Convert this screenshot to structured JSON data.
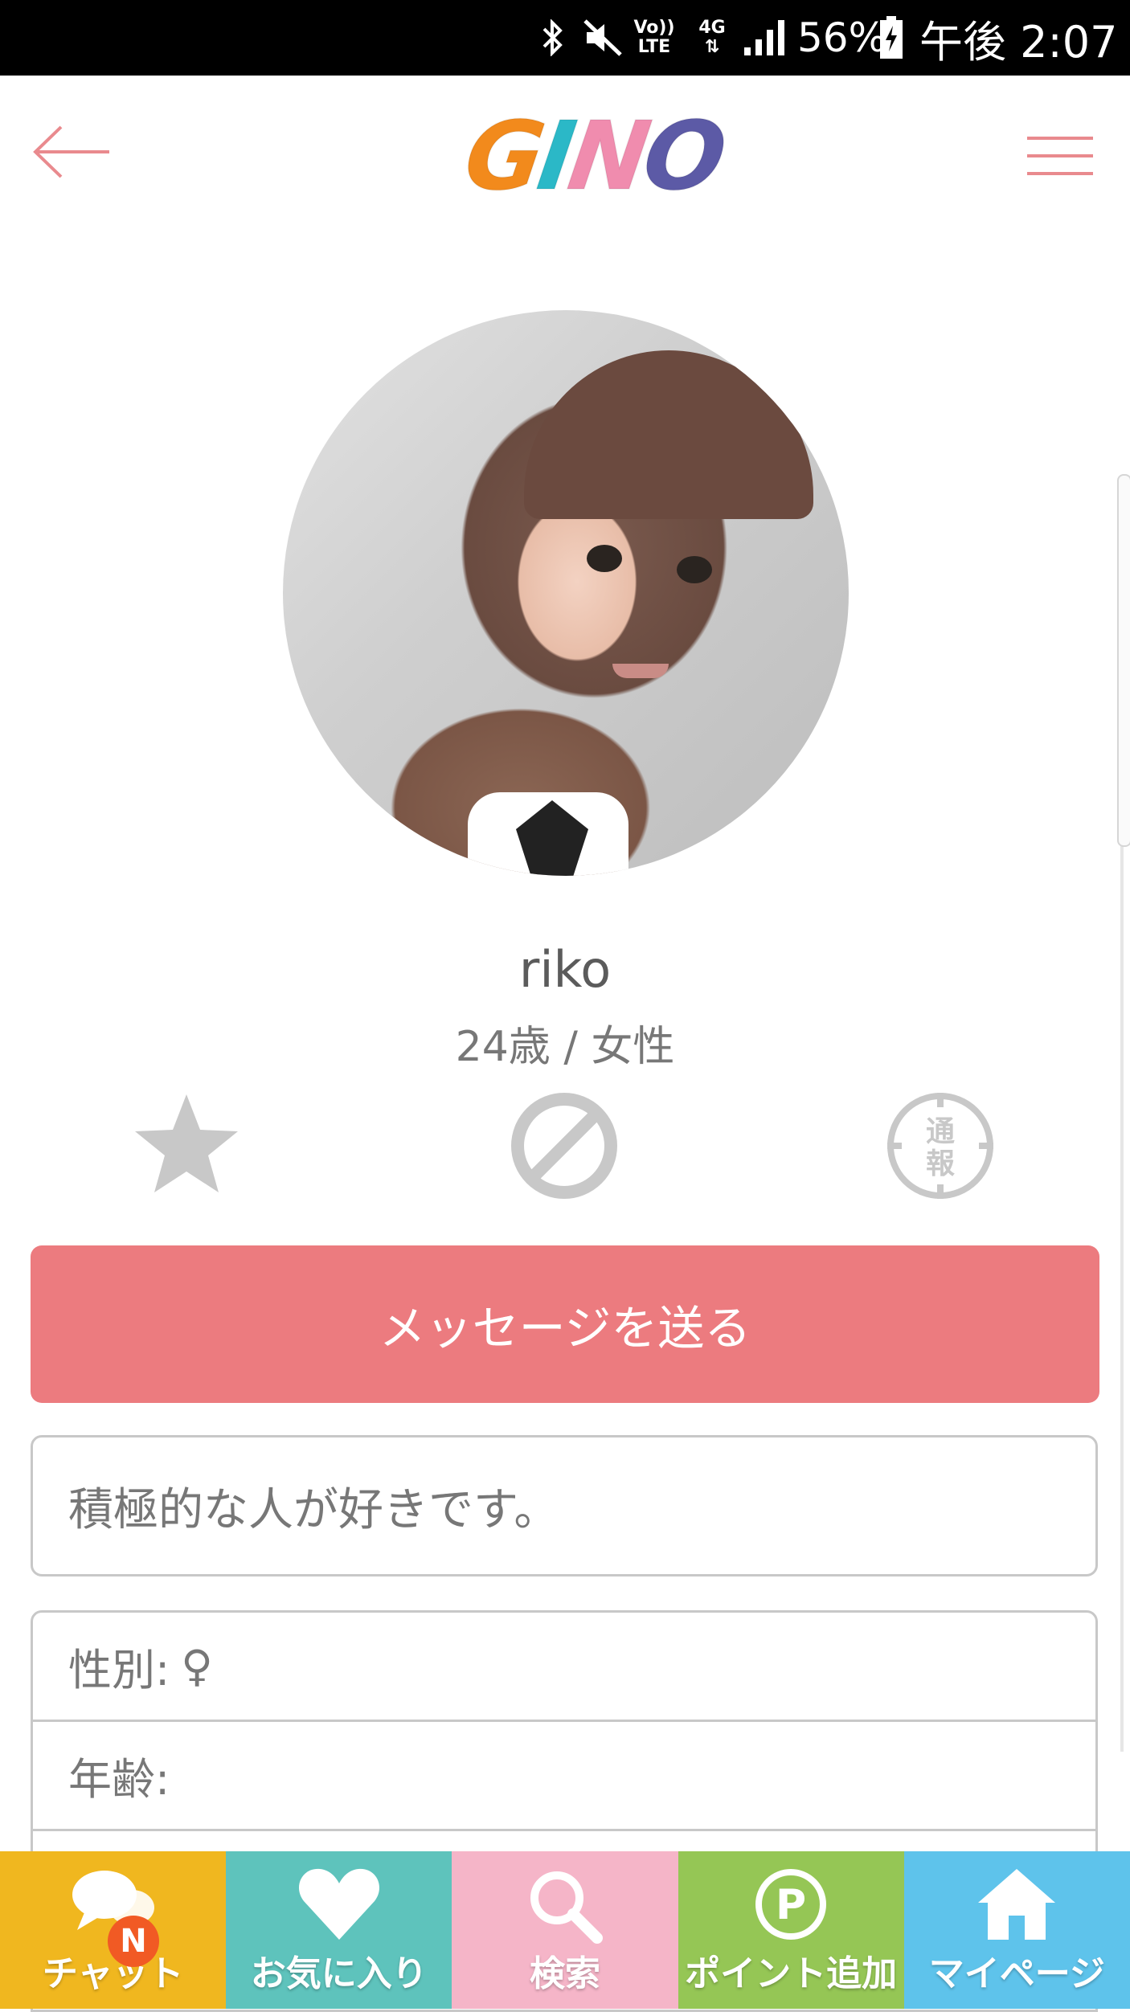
{
  "status_bar": {
    "bluetooth_icon": "bluetooth-icon",
    "volte_top": "Vo))",
    "volte_bottom": "LTE",
    "network_type": "4G",
    "battery_percent": "56%",
    "time": "午後 2:07"
  },
  "header": {
    "logo_letters": [
      "G",
      "I",
      "N",
      "O"
    ],
    "logo_colors": [
      "#f28a1c",
      "#2bb8c7",
      "#f08cae",
      "#5c5aa6"
    ],
    "back_icon": "arrow-left-icon",
    "menu_icon": "hamburger-menu-icon"
  },
  "profile": {
    "username": "riko",
    "age_gender": "24歳 / 女性",
    "actions": {
      "favorite_icon": "star-icon",
      "block_icon": "block-icon",
      "report_icon": "report-icon",
      "report_char1": "通",
      "report_char2": "報"
    },
    "send_message_label": "メッセージを送る",
    "bio": "積極的な人が好きです。",
    "info": [
      {
        "label": "性別:",
        "value": "♀"
      },
      {
        "label": "年齢:",
        "value": ""
      }
    ]
  },
  "bottom_nav": [
    {
      "label": "チャット",
      "color": "#f0b71f",
      "icon": "chat-bubble-icon",
      "badge": "N"
    },
    {
      "label": "お気に入り",
      "color": "#5ec3bc",
      "icon": "heart-icon"
    },
    {
      "label": "検索",
      "color": "#f5b5c8",
      "icon": "search-icon"
    },
    {
      "label": "ポイント追加",
      "color": "#95c655",
      "icon": "point-icon",
      "icon_text": "P"
    },
    {
      "label": "マイページ",
      "color": "#5ec3eb",
      "icon": "home-icon"
    }
  ],
  "accent_color": "#ec7b7f"
}
